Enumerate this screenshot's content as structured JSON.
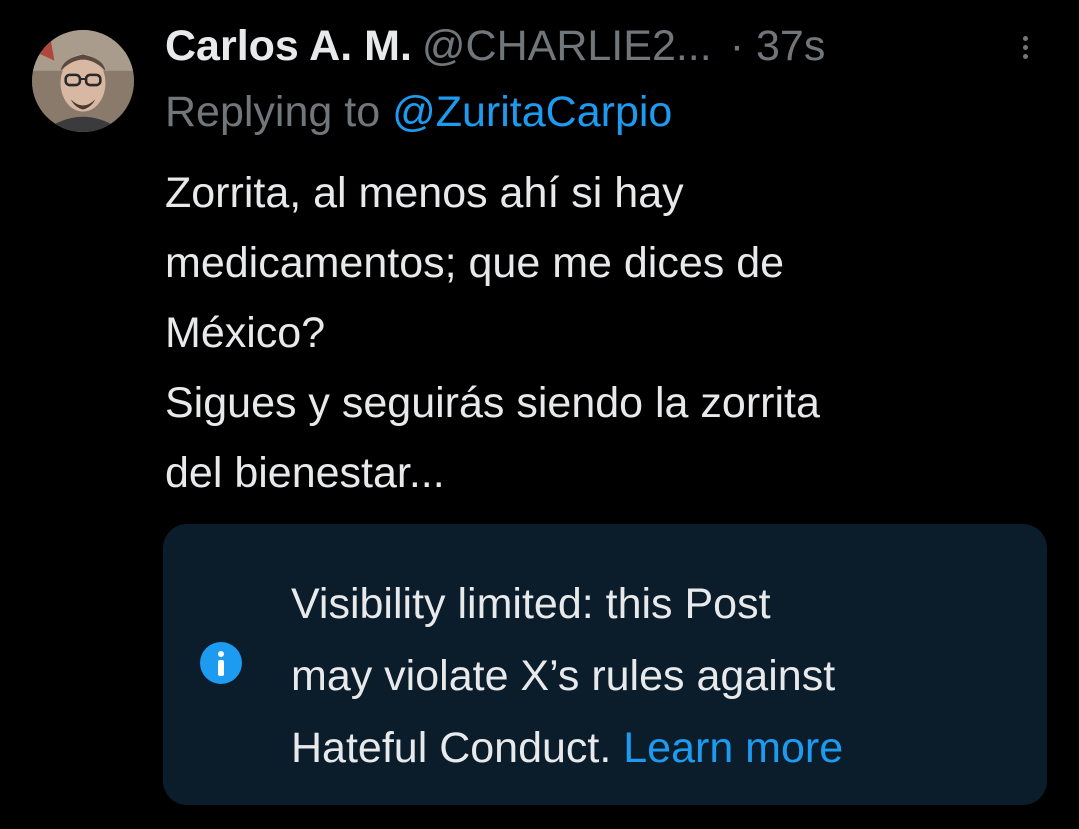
{
  "post": {
    "author": {
      "display_name": "Carlos A. M.",
      "handle": "@CHARLIE2...",
      "avatar_icon": "user-avatar-photo"
    },
    "separator": "·",
    "timestamp": "37s",
    "more_icon": "more-vertical-icon",
    "reply_prefix": "Replying to",
    "reply_to": "@ZuritaCarpio",
    "text_lines": [
      "Zorrita, al menos ahí si hay",
      "medicamentos; que me dices de",
      "México?",
      "Sigues y seguirás siendo la zorrita",
      "del bienestar..."
    ]
  },
  "notice": {
    "icon": "info-icon",
    "lines": [
      "Visibility limited: this Post",
      "may violate X’s rules against",
      "Hateful Conduct."
    ],
    "link_text": "Learn more"
  },
  "colors": {
    "background": "#000000",
    "text_primary": "#e7e9ea",
    "text_secondary": "#71767b",
    "accent": "#1d9bf0",
    "notice_background": "#0b1d2b"
  }
}
